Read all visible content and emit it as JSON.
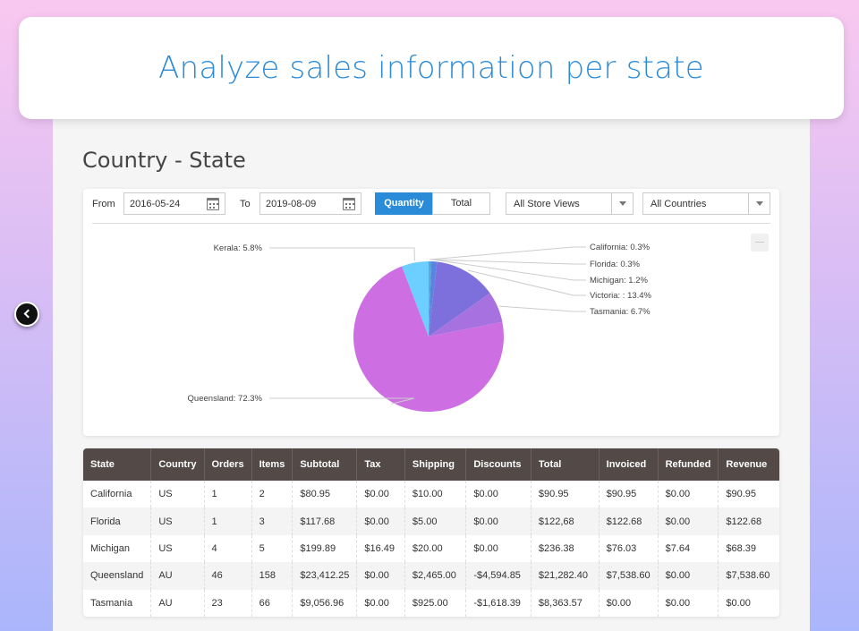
{
  "header": {
    "title": "Analyze sales information per state"
  },
  "section": {
    "title": "Country - State"
  },
  "filters": {
    "from_label": "From",
    "from_value": "2016-05-24",
    "to_label": "To",
    "to_value": "2019-08-09",
    "quantity_label": "Quantity",
    "total_label": "Total",
    "active_mode": "Quantity",
    "store_views": "All Store Views",
    "countries": "All Countries"
  },
  "chart_data": {
    "type": "pie",
    "slices": [
      {
        "label": "Kerala: 5.8%",
        "value": 5.8,
        "color": "#6ccfff"
      },
      {
        "label": "California: 0.3%",
        "value": 0.3,
        "color": "#4db0d6"
      },
      {
        "label": "Florida: 0.3%",
        "value": 0.3,
        "color": "#4f9ed8"
      },
      {
        "label": "Michigan: 1.2%",
        "value": 1.2,
        "color": "#5b84e0"
      },
      {
        "label": "Victoria: : 13.4%",
        "value": 13.4,
        "color": "#7e70dc"
      },
      {
        "label": "Tasmania: 6.7%",
        "value": 6.7,
        "color": "#a772e0"
      },
      {
        "label": "Queensland: 72.3%",
        "value": 72.3,
        "color": "#cd6fe3"
      }
    ]
  },
  "table": {
    "columns": [
      "State",
      "Country",
      "Orders",
      "Items",
      "Subtotal",
      "Tax",
      "Shipping",
      "Discounts",
      "Total",
      "Invoiced",
      "Refunded",
      "Revenue"
    ],
    "rows": [
      [
        "California",
        "US",
        "1",
        "2",
        "$80.95",
        "$0.00",
        "$10.00",
        "$0.00",
        "$90.95",
        "$90.95",
        "$0.00",
        "$90.95"
      ],
      [
        "Florida",
        "US",
        "1",
        "3",
        "$117.68",
        "$0.00",
        "$5.00",
        "$0.00",
        "$122,68",
        "$122.68",
        "$0.00",
        "$122.68"
      ],
      [
        "Michigan",
        "US",
        "4",
        "5",
        "$199.89",
        "$16.49",
        "$20.00",
        "$0.00",
        "$236.38",
        "$76.03",
        "$7.64",
        "$68.39"
      ],
      [
        "Queensland",
        "AU",
        "46",
        "158",
        "$23,412.25",
        "$0.00",
        "$2,465.00",
        "-$4,594.85",
        "$21,282.40",
        "$7,538.60",
        "$0.00",
        "$7,538.60"
      ],
      [
        "Tasmania",
        "AU",
        "23",
        "66",
        "$9,056.96",
        "$0.00",
        "$925.00",
        "-$1,618.39",
        "$8,363.57",
        "$0.00",
        "$0.00",
        "$0.00"
      ]
    ]
  },
  "icons": {
    "back": "chevron-left-icon",
    "calendar": "calendar-icon",
    "dropdown": "chevron-down-icon",
    "menu": "menu-icon"
  }
}
